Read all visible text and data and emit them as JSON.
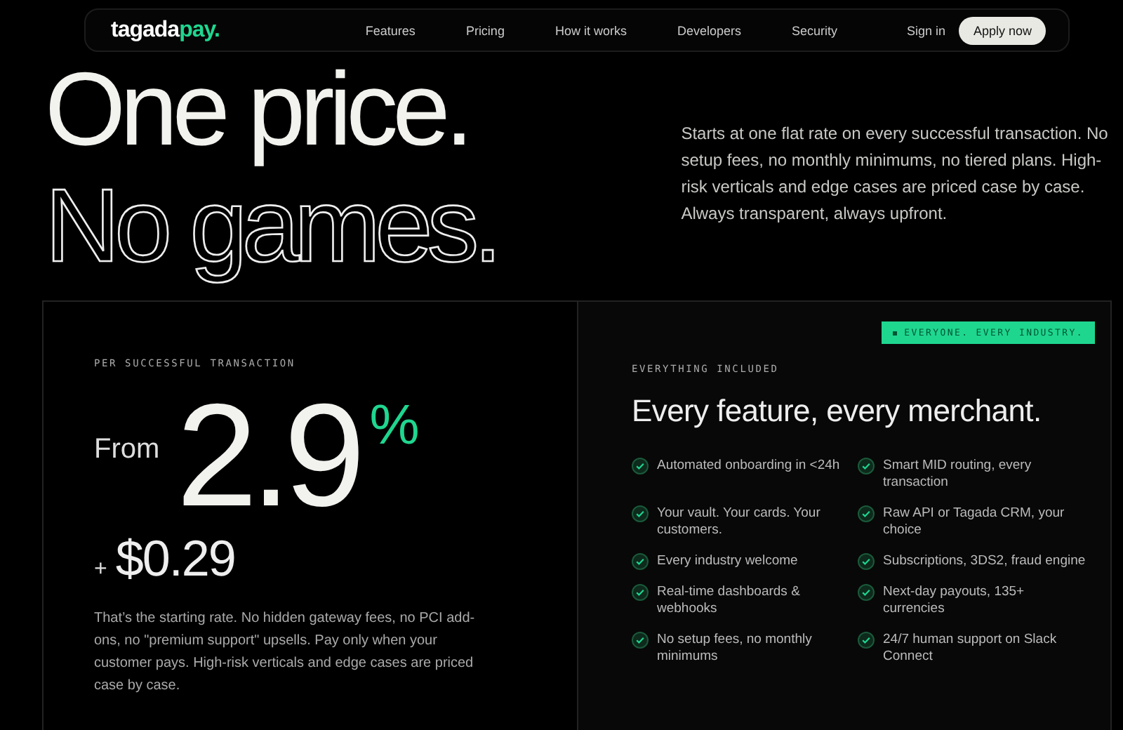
{
  "nav": {
    "logo": [
      {
        "text": "tagada",
        "accent": false
      },
      {
        "text": "pay.",
        "accent": true
      }
    ],
    "links": [
      "Features",
      "Pricing",
      "How it works",
      "Developers",
      "Security"
    ],
    "sign_in": "Sign in",
    "cta": "Apply now"
  },
  "hero": {
    "headline": [
      {
        "text": "One price.",
        "kind": "solid"
      },
      {
        "text": "No games.",
        "kind": "outline"
      }
    ],
    "intro": "Starts at one flat rate on every successful transaction. No setup fees, no monthly minimums, no tiered plans. High-risk verticals and edge cases are priced case by case. Always transparent, always upfront."
  },
  "price_card": {
    "label": "PER SUCCESSFUL TRANSACTION",
    "prefix": "From",
    "rate": "2.9",
    "unit": "%",
    "fee_sign": "+",
    "fee": "$0.29",
    "note": "That’s the starting rate. No hidden gateway fees, no PCI add-ons, no \"premium support\" upsells. Pay only when your customer pays. High-risk verticals and edge cases are priced case by case."
  },
  "features_card": {
    "badge": "EVERYONE. EVERY INDUSTRY.",
    "label": "EVERYTHING INCLUDED",
    "title": "Every feature, every merchant.",
    "features": [
      "Automated onboarding in <24h",
      "Smart MID routing, every transaction",
      "Your vault. Your cards. Your customers.",
      "Raw API or Tagada CRM, your choice",
      "Every industry welcome",
      "Subscriptions, 3DS2, fraud engine",
      "Real-time dashboards & webhooks",
      "Next-day payouts, 135+ currencies",
      "No setup fees, no monthly minimums",
      "24/7 human support on Slack Connect"
    ]
  }
}
